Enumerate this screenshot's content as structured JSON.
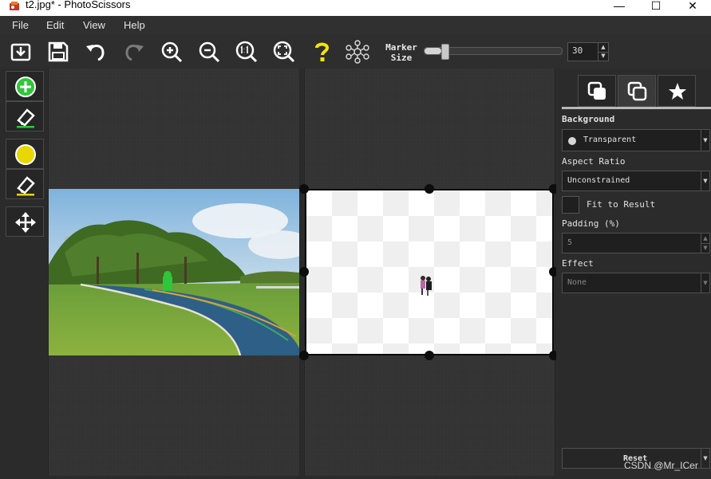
{
  "window": {
    "title": "t2.jpg* - PhotoScissors",
    "minimize": "—",
    "maximize": "☐",
    "close": "✕"
  },
  "menu": [
    "File",
    "Edit",
    "View",
    "Help"
  ],
  "toolbar": {
    "buttons": [
      "open-icon",
      "save-icon",
      "undo-icon",
      "redo-icon",
      "zoom-in-icon",
      "zoom-out-icon",
      "zoom-actual-icon",
      "zoom-fit-icon",
      "help-icon",
      "network-icon"
    ],
    "marker_label_line1": "Marker",
    "marker_label_line2": "Size",
    "marker_size_value": "30",
    "marker_size_fraction": 0.12
  },
  "palette": [
    "add-foreground-marker-icon",
    "erase-foreground-icon",
    "add-background-marker-icon",
    "erase-background-icon",
    "move-icon"
  ],
  "panel": {
    "tabs": [
      "background-tab-icon",
      "copy-tab-icon",
      "favorite-tab-icon"
    ],
    "background_label": "Background",
    "background_value": "Transparent",
    "aspect_ratio_label": "Aspect Ratio",
    "aspect_ratio_value": "Unconstrained",
    "fit_to_result_label": "Fit to Result",
    "padding_label": "Padding (%)",
    "padding_value": "5",
    "effect_label": "Effect",
    "effect_value": "None",
    "reset_label": "Reset"
  },
  "watermark": "CSDN @Mr_ICer",
  "colors": {
    "accent_green": "#2ec63a",
    "accent_yellow": "#e8d700",
    "help_yellow": "#f5e400",
    "window_accent": "#1b78d4"
  }
}
